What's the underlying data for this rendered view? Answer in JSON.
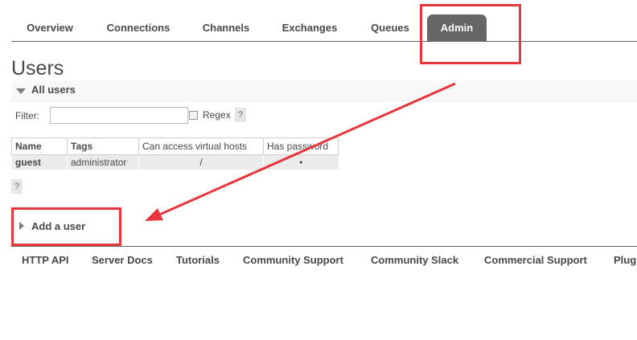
{
  "nav": {
    "tabs": [
      {
        "label": "Overview"
      },
      {
        "label": "Connections"
      },
      {
        "label": "Channels"
      },
      {
        "label": "Exchanges"
      },
      {
        "label": "Queues"
      },
      {
        "label": "Admin",
        "active": true
      }
    ]
  },
  "page": {
    "title": "Users"
  },
  "all_users": {
    "header": "All users",
    "filter": {
      "label": "Filter:",
      "value": "",
      "placeholder": "",
      "regex_label": "Regex",
      "regex_checked": false,
      "help": "?"
    },
    "table": {
      "columns": [
        "Name",
        "Tags",
        "Can access virtual hosts",
        "Has password"
      ],
      "rows": [
        {
          "name": "guest",
          "tags": "administrator",
          "vhosts": "/",
          "has_password": "•"
        }
      ]
    },
    "help": "?"
  },
  "add_user": {
    "header": "Add a user"
  },
  "footer": {
    "links": [
      "HTTP API",
      "Server Docs",
      "Tutorials",
      "Community Support",
      "Community Slack",
      "Commercial Support",
      "Plug"
    ]
  },
  "annotation": {
    "color": "#e8373c"
  },
  "theme": {
    "active_tab_bg": "#666666",
    "text": "#484848",
    "row_bg": "#ebebeb"
  }
}
